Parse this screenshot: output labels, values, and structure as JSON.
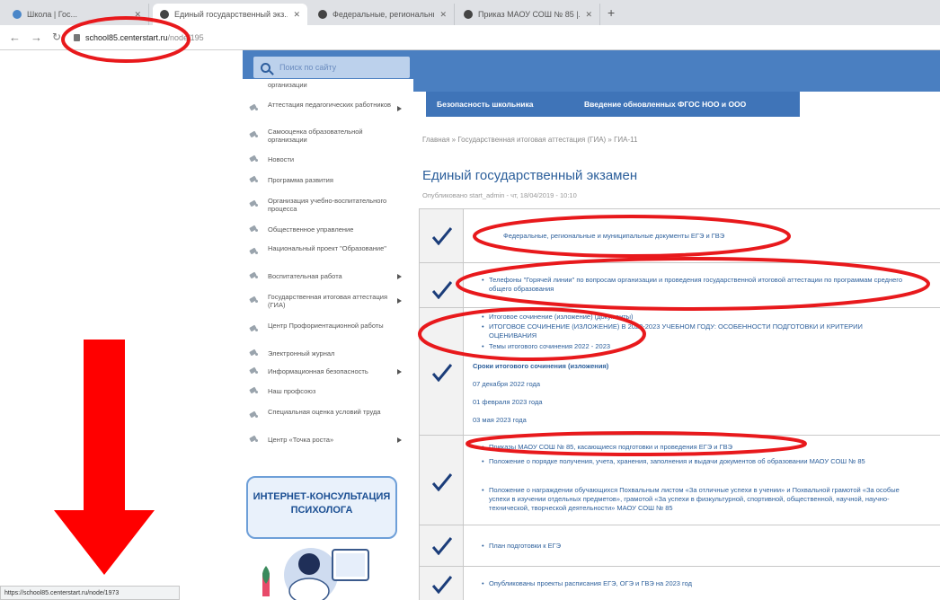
{
  "browser": {
    "tabs": [
      {
        "title": "Школа | Гос...",
        "active": false
      },
      {
        "title": "Единый государственный экз...",
        "active": true
      },
      {
        "title": "Федеральные, региональные и...",
        "active": false
      },
      {
        "title": "Приказ МАОУ СОШ № 85 |...",
        "active": false
      }
    ],
    "new_tab_label": "+",
    "back_label": "←",
    "forward_label": "→",
    "url_host": "school85.centerstart.ru",
    "url_path": "/node/195",
    "status_url": "https://school85.centerstart.ru/node/1973"
  },
  "search": {
    "placeholder": "Поиск по сайту"
  },
  "sidebar": {
    "items": [
      {
        "label": "организации",
        "arrow": false
      },
      {
        "label": "Аттестация педагогических работников",
        "arrow": true
      },
      {
        "label": "Самооценка образовательной организации",
        "arrow": false
      },
      {
        "label": "Новости",
        "arrow": false
      },
      {
        "label": "Программа развития",
        "arrow": false
      },
      {
        "label": "Организация учебно-воспитательного процесса",
        "arrow": false
      },
      {
        "label": "Общественное управление",
        "arrow": false
      },
      {
        "label": "Национальный проект \"Образование\"",
        "arrow": false
      },
      {
        "label": "Воспитательная работа",
        "arrow": true
      },
      {
        "label": "Государственная итоговая аттестация (ГИА)",
        "arrow": true
      },
      {
        "label": "Центр Профориентационной работы",
        "arrow": false
      },
      {
        "label": "Электронный журнал",
        "arrow": false
      },
      {
        "label": "Информационная безопасность",
        "arrow": true
      },
      {
        "label": "Наш профсоюз",
        "arrow": false
      },
      {
        "label": "Специальная оценка условий труда",
        "arrow": false
      },
      {
        "label": "Центр «Точка роста»",
        "arrow": true
      }
    ],
    "banner_line1": "ИНТЕРНЕТ-КОНСУЛЬТАЦИЯ",
    "banner_line2": "ПСИХОЛОГА"
  },
  "topnav": {
    "items": [
      "Безопасность школьника",
      "Введение обновленных ФГОС НОО и ООО"
    ]
  },
  "breadcrumb": "Главная » Государственная итоговая аттестация (ГИА) » ГИА-11",
  "page": {
    "title": "Единый государственный экзамен",
    "meta": "Опубликовано start_admin - чт, 18/04/2019 - 10:10"
  },
  "rows": [
    {
      "links": [
        "Федеральные, региональные и муниципальные документы ЕГЭ и ГВЭ"
      ]
    },
    {
      "links": [
        "Телефоны \"Горячей линии\" по вопросам организации и проведения государственной итоговой аттестации по программам среднего общего образования"
      ]
    },
    {
      "links": [
        "Итоговое сочинение (изложение) (документы)",
        "ИТОГОВОЕ СОЧИНЕНИЕ (ИЗЛОЖЕНИЕ) В 2022-2023 УЧЕБНОМ ГОДУ: ОСОБЕННОСТИ ПОДГОТОВКИ И КРИТЕРИИ ОЦЕНИВАНИЯ",
        "Темы итогового сочинения 2022 - 2023"
      ],
      "dates_title": "Сроки итогового сочинения (изложения)",
      "dates": [
        "07 декабря 2022 года",
        "01 февраля 2023 года",
        "03 мая 2023 года"
      ]
    },
    {
      "links": [
        "Приказы МАОУ СОШ № 85, касающиеся подготовки и проведения ЕГЭ и ГВЭ",
        "Положение о порядке получения, учета, хранения, заполнения и выдачи документов об образовании МАОУ СОШ № 85",
        "Положение о награждении обучающихся Похвальным листом «За отличные успехи в учении» и Похвальной грамотой «За особые успехи в изучении отдельных предметов», грамотой «За успехи в физкультурной, спортивной, общественной, научной, научно-технической, творческой деятельности» МАОУ СОШ № 85"
      ]
    },
    {
      "links": [
        "План подготовки к ЕГЭ"
      ]
    },
    {
      "links": [
        "Опубликованы проекты расписания ЕГЭ, ОГЭ и ГВЭ на 2023 год"
      ]
    }
  ],
  "colors": {
    "header_blue": "#4a7fc1",
    "nav_blue": "#3f74b8",
    "link_blue": "#2c5f9b",
    "annotation_red": "#e8191c"
  }
}
